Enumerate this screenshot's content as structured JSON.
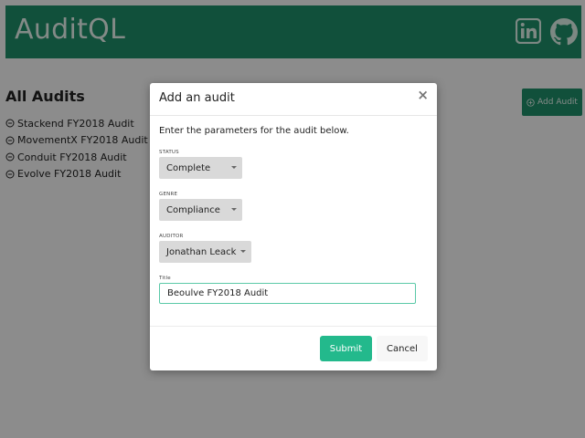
{
  "header": {
    "brand": "AuditQL",
    "icons": [
      "linkedin-icon",
      "github-icon"
    ],
    "color": "#1f8f6a"
  },
  "main": {
    "title": "All Audits",
    "add_button_label": "Add Audit",
    "audits": [
      "Stackend FY2018 Audit",
      "MovementX FY2018 Audit",
      "Conduit FY2018 Audit",
      "Evolve FY2018 Audit"
    ]
  },
  "modal": {
    "title": "Add an audit",
    "close_label": "×",
    "intro": "Enter the parameters for the audit below.",
    "status": {
      "label": "STATUS",
      "value": "Complete"
    },
    "genre": {
      "label": "GENRE",
      "value": "Compliance"
    },
    "auditor": {
      "label": "AUDITOR",
      "value": "Jonathan Leack"
    },
    "title_field": {
      "label": "Title",
      "value": "Beoulve FY2018 Audit"
    },
    "submit_label": "Submit",
    "cancel_label": "Cancel",
    "accent": "#23b98c"
  }
}
